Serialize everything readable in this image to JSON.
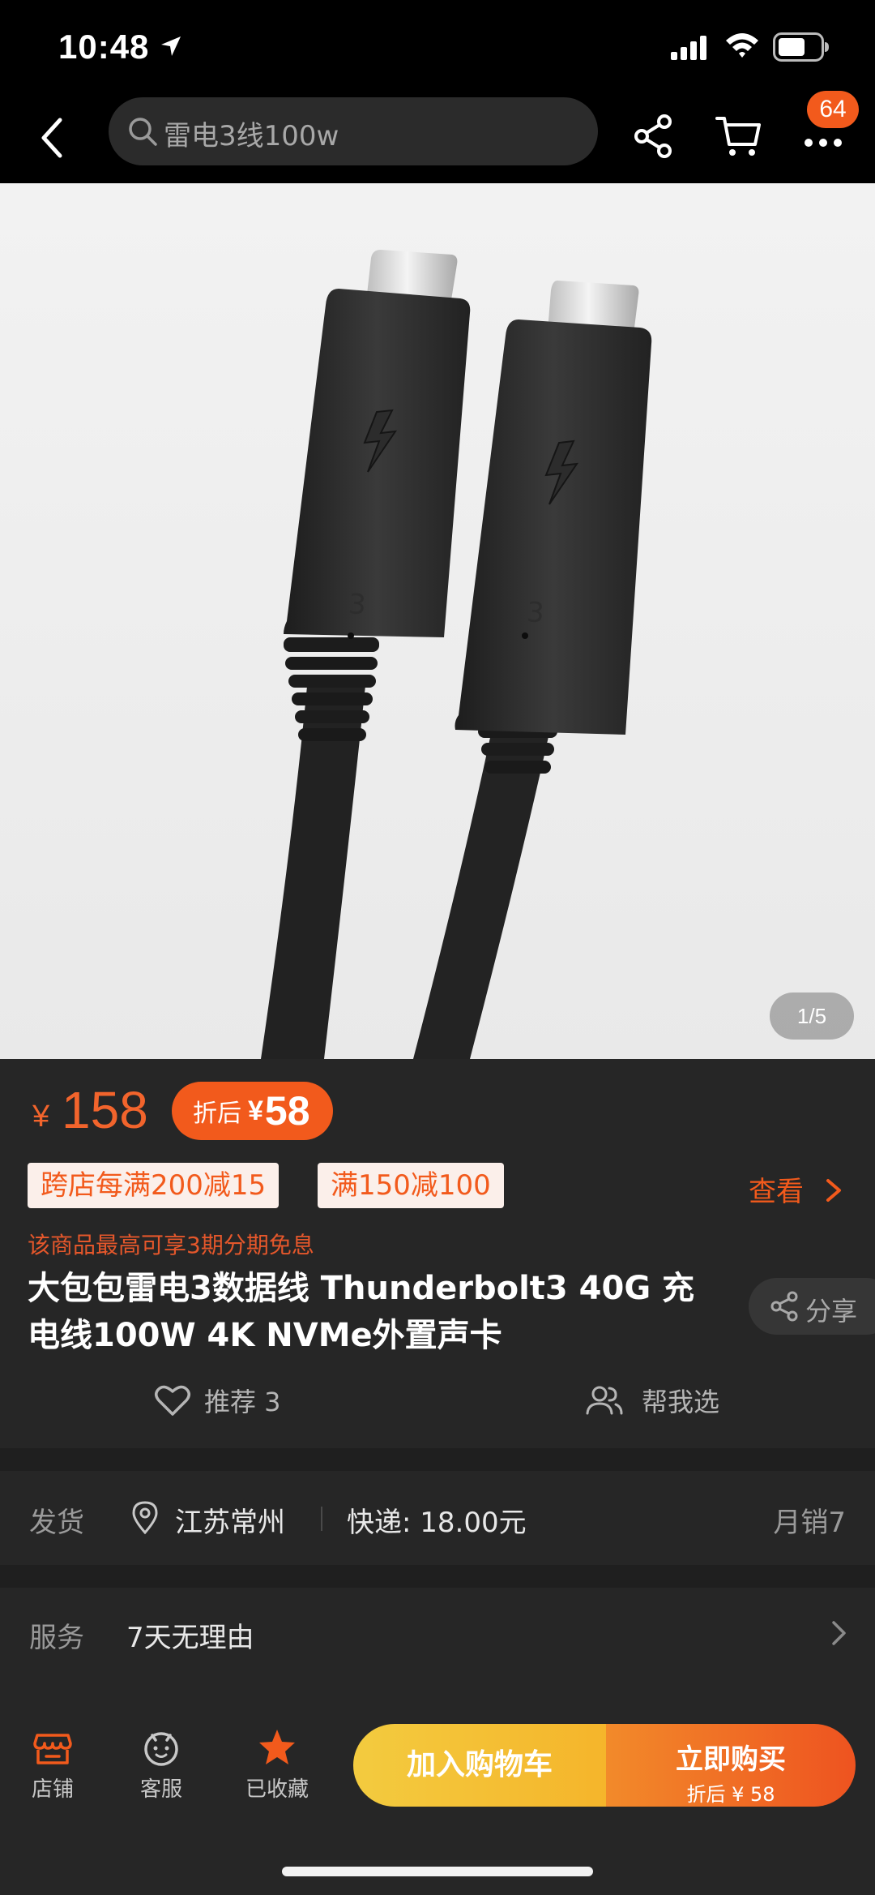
{
  "status_bar": {
    "time": "10:48"
  },
  "nav": {
    "search_text": "雷电3线100w",
    "badge_count": "64"
  },
  "gallery": {
    "counter": "1/5"
  },
  "price": {
    "currency": "¥",
    "original": "158",
    "discount_label": "折后",
    "discount_currency": "¥",
    "discount_value": "58"
  },
  "promotions": {
    "tags": [
      "跨店每满200减15",
      "满150减100"
    ],
    "view_label": "查看"
  },
  "installment": "该商品最高可享3期分期免息",
  "product": {
    "title": "大包包雷电3数据线 Thunderbolt3 40G 充电线100W 4K NVMe外置声卡",
    "share_label": "分享"
  },
  "actions": {
    "recommend_label": "推荐 3",
    "help_label": "帮我选"
  },
  "delivery": {
    "label": "发货",
    "location": "江苏常州",
    "fee": "快递: 18.00元",
    "monthly_sales": "月销7"
  },
  "service": {
    "label": "服务",
    "value": "7天无理由"
  },
  "bottom_bar": {
    "store_label": "店铺",
    "service_label": "客服",
    "favorite_label": "已收藏",
    "cart_label": "加入购物车",
    "buy_label": "立即购买",
    "buy_sub": "折后 ¥ 58"
  },
  "colors": {
    "accent": "#f25a1c",
    "cart_button": "#f3c43c",
    "buy_button": "#ee5a20",
    "panel": "#262626"
  },
  "icons": [
    "location-arrow-icon",
    "signal-icon",
    "wifi-icon",
    "battery-icon",
    "back-icon",
    "search-icon",
    "share-icon",
    "cart-icon",
    "more-icon",
    "chevron-right-icon",
    "heart-icon",
    "people-icon",
    "map-pin-icon",
    "store-icon",
    "customer-service-icon",
    "star-icon"
  ]
}
